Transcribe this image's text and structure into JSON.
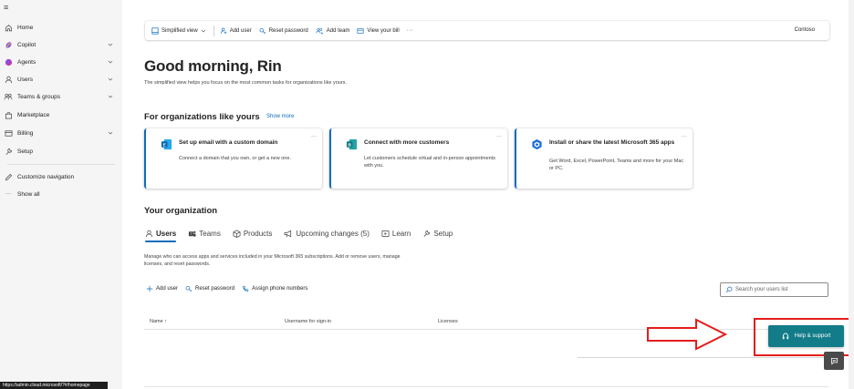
{
  "sidebar": {
    "items": [
      {
        "label": "Home",
        "icon": "home-icon",
        "chevron": false
      },
      {
        "label": "Copilot",
        "icon": "copilot-icon",
        "chevron": true
      },
      {
        "label": "Agents",
        "icon": "agents-icon",
        "chevron": true
      },
      {
        "label": "Users",
        "icon": "person-icon",
        "chevron": true
      },
      {
        "label": "Teams & groups",
        "icon": "people-team-icon",
        "chevron": true
      },
      {
        "label": "Marketplace",
        "icon": "shopping-bag-icon",
        "chevron": false
      },
      {
        "label": "Billing",
        "icon": "credit-card-icon",
        "chevron": true
      },
      {
        "label": "Setup",
        "icon": "wrench-icon",
        "chevron": false
      }
    ],
    "customize_label": "Customize navigation",
    "show_all_label": "Show all",
    "ellipsis": "···"
  },
  "statusbar": {
    "url": "https://admin.cloud.microsoft/?#/homepage"
  },
  "cmdbar": {
    "view_label": "Simplified view",
    "add_user": "Add user",
    "reset_password": "Reset password",
    "add_team": "Add team",
    "view_bill": "View your bill",
    "more": "···",
    "tenant": "Contoso"
  },
  "greeting": "Good morning, Rin",
  "subtitle": "The simplified view helps you focus on the most common tasks for organizations like yours.",
  "recommendations": {
    "title": "For organizations like yours",
    "show_more": "Show more",
    "cards": [
      {
        "title": "Set up email with a custom domain",
        "desc": "Connect a domain that you own, or get a new one."
      },
      {
        "title": "Connect with more customers",
        "desc": "Let customers schedule virtual and in-person appointments with you."
      },
      {
        "title": "Install or share the latest Microsoft 365 apps",
        "desc": "Get Word, Excel, PowerPoint, Teams and more for your Mac or PC."
      }
    ],
    "card_more": "···"
  },
  "org": {
    "title": "Your organization",
    "tabs": [
      "Users",
      "Teams",
      "Products",
      "Upcoming changes (5)",
      "Learn",
      "Setup"
    ],
    "description": "Manage who can access apps and services included in your Microsoft 365 subscriptions. Add or remove users, manage licenses, and reset passwords.",
    "actions": {
      "add_user": "Add user",
      "reset_password": "Reset password",
      "assign_phone": "Assign phone numbers"
    },
    "search_placeholder": "Search your users list",
    "columns": [
      "Name ↑",
      "Username for sign-in",
      "Licenses"
    ]
  },
  "help": {
    "label": "Help & support"
  },
  "colors": {
    "accent": "#0f6cbd",
    "help_button": "#127c89",
    "annotation": "#e41d1d"
  }
}
